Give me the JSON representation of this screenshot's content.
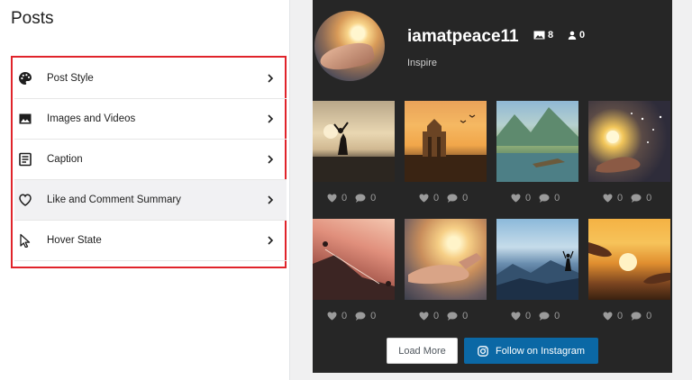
{
  "panel": {
    "title": "Posts",
    "items": [
      {
        "label": "Post Style",
        "icon": "palette-icon"
      },
      {
        "label": "Images and Videos",
        "icon": "image-icon"
      },
      {
        "label": "Caption",
        "icon": "caption-icon"
      },
      {
        "label": "Like and Comment Summary",
        "icon": "heart-icon"
      },
      {
        "label": "Hover State",
        "icon": "cursor-icon"
      }
    ],
    "highlight_color": "#e0242b"
  },
  "profile": {
    "username": "iamatpeace11",
    "posts_count": "8",
    "followers_count": "0",
    "bio": "Inspire"
  },
  "posts": [
    {
      "likes": "0",
      "comments": "0"
    },
    {
      "likes": "0",
      "comments": "0"
    },
    {
      "likes": "0",
      "comments": "0"
    },
    {
      "likes": "0",
      "comments": "0"
    },
    {
      "likes": "0",
      "comments": "0"
    },
    {
      "likes": "0",
      "comments": "0"
    },
    {
      "likes": "0",
      "comments": "0"
    },
    {
      "likes": "0",
      "comments": "0"
    }
  ],
  "buttons": {
    "load_more": "Load More",
    "follow": "Follow on Instagram"
  },
  "colors": {
    "feed_background": "#262626",
    "follow_button": "#0b68a5"
  }
}
